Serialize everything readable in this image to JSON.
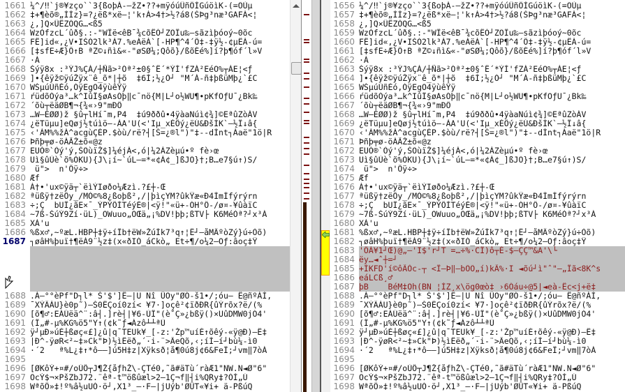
{
  "colors": {
    "diff_bg": "#c0c0c0",
    "diff_text": "#8b1a1a",
    "gutter_diff": "#ffff00",
    "line_number": "#8a8a8a"
  },
  "left": {
    "first_line": 1661,
    "current_line": 1687
  },
  "right": {
    "first_line": 1656
  },
  "rows": [
    {
      "l": "1661",
      "r": "1656",
      "t": "¼^/‼`j®¥zço``3{ßoþÁ-–žZ•??+mÿóúÛñÔÌGúöìK-(=ÕÙµ"
    },
    {
      "l": "1662",
      "r": "1657",
      "t": "‡+¶èõ®„ÌÌz}=?¿ëß*xë–¦'k↑Á>4†>½?á8(ŠÞg³næ³GAFÁ<¦"
    },
    {
      "l": "1663",
      "r": "1658",
      "t": "¿,]Q×ÛËZÒQG…<ß5"
    },
    {
      "l": "1664",
      "r": "1659",
      "t": "WzÒfzcL´ûð§.:-\"WÏë<êB¯¾cõËÓ┘ZÕÏu‰–sãzìþóoý~0õc"
    },
    {
      "l": "1665",
      "r": "1660",
      "t": "FÊ]id«,¿V•IŠÓ2lk³Á7.%eÁëÁ`[-HP¶^4´Ö‡-‡ÿ½-¢µËÁ-ú="
    },
    {
      "l": "1666",
      "r": "1661",
      "t": "[‡sfE÷Æ}Ö↑B ªZ©↓ñì&«-\"øSØ¼;Qôõ}/ßõÉé%]í?þ¶óf´l»V"
    },
    {
      "l": "1667",
      "r": "1662",
      "t": "·Á"
    },
    {
      "l": "1668",
      "r": "1663",
      "t": "Šýÿ8x :³ÝJ%ÇÁ/┼Ñã>²Óª²±0§ˆË´*ÝÍ'fZÁ²EéO%┬ÁE¦<ƒ"
    },
    {
      "l": "1669",
      "r": "1664",
      "t": "]•{êÿž©ÿúŽÿx¨ê_õ*|┼õ  ‡6Ì;½¿Ó┘ \"M´Á-ñ‡þßüMþ¿`£C"
    },
    {
      "l": "1670",
      "r": "1665",
      "t": "WŠµúÙñÈó,ÓÿEgÕ4ÿùêŸÿ"
    },
    {
      "l": "1671",
      "r": "1666",
      "t": "ŕüdõÓýa³…k^IûÏ§øAsÓþ‖c¯nö{M|L┘o½WU¶•pKfOƒU¯¿Bk‰"
    },
    {
      "l": "1672",
      "r": "1667",
      "t": "´õù┬ëäØB¶¬{¾«›9\"mÐÔ"
    },
    {
      "l": "1673",
      "r": "1668",
      "t": "…W–ÉØØ)ž §û┬lHí¯m,P4  ‡ú9ððû•4ÿàaNúì¢¾]©EªûZòÁV"
    },
    {
      "l": "1674",
      "r": "1669",
      "t": "¿ëTüµu]eQøj½túìö–-ÀA'U(<'Iµ_xÉÖý¿ëÚ&ÐšÍK`–½Ï↓â{"
    },
    {
      "l": "1675",
      "r": "1670",
      "t": "‹'ÁM%%žÁ^acgùÇÉP.$òù/rë?┤[Š=¿®l\")\"‡--dÍnt┐Áaë\"1ö|R"
    },
    {
      "l": "1676",
      "r": "1671",
      "t": "Þñþ╤ø-öÁÃŽ±õ«@z"
    },
    {
      "l": "1677",
      "r": "1672",
      "t": "EUÒ®`Òý'ý,ŠÕùïŽ$]¼éjÁ<,ó|¼2ÁZèµú•º fè›œ"
    },
    {
      "l": "1678",
      "r": "1673",
      "t": "Uì§ûÙè`õ%ÒKU){J\\¡í~`úL–=*«¢Á¢_]ßJÕ}†;B…e7§ú↑)S/"
    },
    {
      "l": "1679",
      "r": "1674",
      "t": " ü\">  n'Öÿ÷>"
    },
    {
      "l": "1680",
      "r": "1675",
      "t": "Æf"
    },
    {
      "l": "1681",
      "r": "1676",
      "t": "Á†•'ux©ÿä┬`ëìÝIøðo¼Æzì.?£┼-Œ"
    },
    {
      "l": "1682",
      "r": "1677",
      "t": "ªüßÿ†zëÖy_/MÓ©%8¿ßoþß²,/|þìçYM?ûkŸæ«Ð4ÌmÍfýrýrn"
    },
    {
      "l": "1683",
      "r": "1678",
      "t": "÷;Ç  bUÏ¿ãE×¯_ÝPÝÖÌTéýÈ®|<ÿ!\"«ü+-ÓH°Ö-/ø¤-¥ûàïC"
    },
    {
      "l": "1684",
      "r": "1679",
      "t": "~7ß-ŠúÝ9Zí·üL)_ÕWuuo„ÕŒä„¡%DV!þþ;ßTV├ K6MéÒª?┘x³Á"
    },
    {
      "l": "1685",
      "r": "1680",
      "t": "XÀ'u"
    },
    {
      "l": "1686",
      "r": "1681",
      "t": "%ßx♂,~ºæL.HBP┼‡ÿ÷íÎb†ëW»ŽúÍk7³q↑¦Ë┘–åMÄºòZý}ú÷Òõ)"
    },
    {
      "l": "1687",
      "r": "1682",
      "t": "┐øâH%þuï†¶ëÁ9¨½z‡(x«ðIÓ_áCkò„ Et÷¶/o¼2–Oƒ:âoç‡Ÿ",
      "cur": true
    },
    {
      "l": "",
      "r": "1683",
      "t": "'ÖÁ¥1┘Œ)@„–'I$'r┘T =…÷%·CÏ)ô┬É-$–ÇÇ™&A'\\└",
      "diff": true
    },
    {
      "l": "",
      "r": "1684",
      "t": "ëy…◄ˆ┼=┘",
      "diff": true
    },
    {
      "l": "",
      "r": "1685",
      "t": "+ÍKFD'í©ôÂÒc-┬ <Ï–Þ‖–bÕÕ„í)kÂ%·I ◄õú┘ì\"ˆ\"–„Ïã<8K^s",
      "diff": true
    },
    {
      "l": "",
      "r": "1686",
      "t": "eáLCß¸♂",
      "diff": true
    },
    {
      "l": "",
      "r": "1687",
      "t": "þB    BéM‡Oh(BN ¦ÌZ¸x\\ög0œò‡ ›6Óáu÷@5|◄eà-Ëc<j+ë‡",
      "diff": true
    },
    {
      "l": "1688",
      "r": "1688",
      "t": ".Á–°°èPf\"D┐l* Š'$']Ë–|U Nî ÜÕy\"ØÓ-š1•/;óu– Ë@ñºÁÌ,"
    },
    {
      "l": "1689",
      "r": "1689",
      "t": "¯XÝÄÁU}è0p˜)–Š0ËÇoí0zí< ¥7·]oçê²¢ïðÐR{ûÝrõx?ë/(%"
    },
    {
      "l": "1690",
      "r": "1690",
      "t": "[õ¶♂:EÁÚëä^¨:â┤.]rè┤|¥6-ÙÏ\"(è˚Ç»¿bßÿ()×UûDMW0jÓ4'"
    },
    {
      "l": "1691",
      "r": "1691",
      "t": "(Î„#-µ%KG%ö5\"Y↑(¢k˜ƒ◄Ázô┴┴ªÙ"
    },
    {
      "l": "1692",
      "r": "1692",
      "t": "ÿ┘µÐ»úÈ┼ßøç«£]¿û|q¯TEUk¥_[-z:'Žp™uíÉ↑õêý-«ÿ@Ð)–Ë‡"
    },
    {
      "l": "1693",
      "r": "1693",
      "t": "|Ð^-ÿøR<²~‡»Ck\"Þ)½ìËëð„´·i-¨>ÂeQõ,‹;íÍ–í┘bù¼-ì0"
    },
    {
      "l": "1694",
      "r": "1694",
      "t": "·´2   ª%L¿‡↑*ô––]ú5H‡z|Xÿksð¦å¶0ú8j¢6&FeÏ;┘vm‖7òÁ"
    },
    {
      "l": "1695",
      "r": "1695",
      "t": ""
    },
    {
      "l": "1696",
      "r": "1696",
      "t": "[ØKôÝ+¤#/oÙÖ┬J¶Ž{åƒhŽ\\-ÇTé0,˜ã#äTù´ràÆ1\"NW.N◄Ø\"6\""
    },
    {
      "l": "1697",
      "r": "1697",
      "t": "ÕcÝ$¬×PšZbJ72.¨êª-t™ößûæl>2–1Ç¬f‖┤i%QRy‡?ÒÌ„Ú"
    },
    {
      "l": "1698",
      "r": "1698",
      "t": "WªõÖ»‡!º%â½uUÓ·ö┘,X1³_–·F–|jUýb'ØÜT«¥i+ ä-PßúQ"
    }
  ],
  "icons": {
    "merge": "arrow-left-icon",
    "cursor": "mouse-pointer-icon",
    "scroll_up": "scroll-up-icon"
  }
}
